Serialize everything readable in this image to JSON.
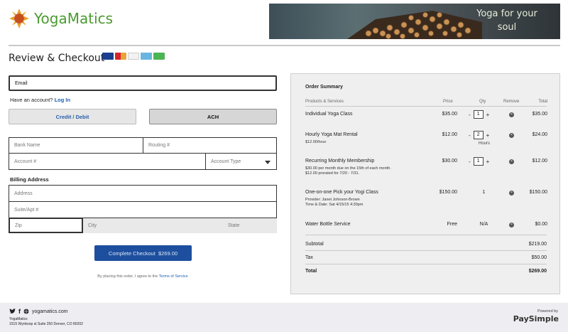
{
  "header": {
    "logo_text": "YogaMatics",
    "banner_text": "Yoga for your soul"
  },
  "page_title": "Review & Checkout",
  "card_icons": [
    {
      "name": "visa-icon",
      "color": "#1a3f8f"
    },
    {
      "name": "mastercard-icon",
      "color": "#e8a33b"
    },
    {
      "name": "discover-icon",
      "color": "#f2f2f2"
    },
    {
      "name": "amex-icon",
      "color": "#6ab5df"
    },
    {
      "name": "other-card-icon",
      "color": "#4ab552"
    }
  ],
  "form": {
    "email_placeholder": "Email",
    "have_account": "Have an account?",
    "login_link": "Log In",
    "credit_label": "Credit / Debit",
    "ach_label": "ACH",
    "bank_name": "Bank Name",
    "routing": "Routing #",
    "account": "Account #",
    "account_type": "Account Type",
    "billing_label": "Billing Address",
    "address": "Address",
    "suite": "Suite/Apt #",
    "zip": "Zip",
    "city": "City",
    "state": "State",
    "checkout_label": "Complete Checkout",
    "checkout_amount": "$269.00",
    "agree_text": "By placing this order, I agree to the",
    "terms_link": "Terms of Service"
  },
  "summary": {
    "title": "Order Summary",
    "headers": {
      "product": "Products & Services",
      "price": "Price",
      "qty": "Qty",
      "remove": "Remove",
      "total": "Total"
    },
    "items": [
      {
        "name": "Individual Yoga Class",
        "sub": "",
        "price": "$35.00",
        "qty": "1",
        "stepper": true,
        "total": "$35.00"
      },
      {
        "name": "Hourly Yoga Mat Rental",
        "sub": "$12.00/hour",
        "price": "$12.00",
        "qty": "2",
        "stepper": true,
        "unit": "Hours",
        "total": "$24.00"
      },
      {
        "name": "Recurring Monthly Membership",
        "sub": "$30.00 per month due on the 15th of each month.",
        "sub2": "$12.00 prorated for 7/20 - 7/31.",
        "price": "$30.00",
        "qty": "1",
        "stepper": true,
        "total": "$12.00"
      },
      {
        "name": "One-on-one Pick your Yogi Class",
        "sub": "Provider: Janet Johnson-Brown",
        "sub2": "Time & Date: Sat 4/15/15 4:30pm",
        "price": "$150.00",
        "qty": "1",
        "stepper": false,
        "total": "$150.00"
      },
      {
        "name": "Water Bottle Service",
        "sub": "",
        "price": "Free",
        "qty": "N/A",
        "stepper": false,
        "total": "$0.00"
      }
    ],
    "subtotal_label": "Subtotal",
    "subtotal": "$219.00",
    "tax_label": "Tax",
    "tax": "$50.00",
    "total_label": "Total",
    "total": "$269.00"
  },
  "footer": {
    "website": "yogamatics.com",
    "company": "YogaMatics",
    "address": "1515 Wynkoop st Suite 250 Denver, CO 80202",
    "powered_by": "Powered by",
    "paysimple": "PaySimple"
  }
}
